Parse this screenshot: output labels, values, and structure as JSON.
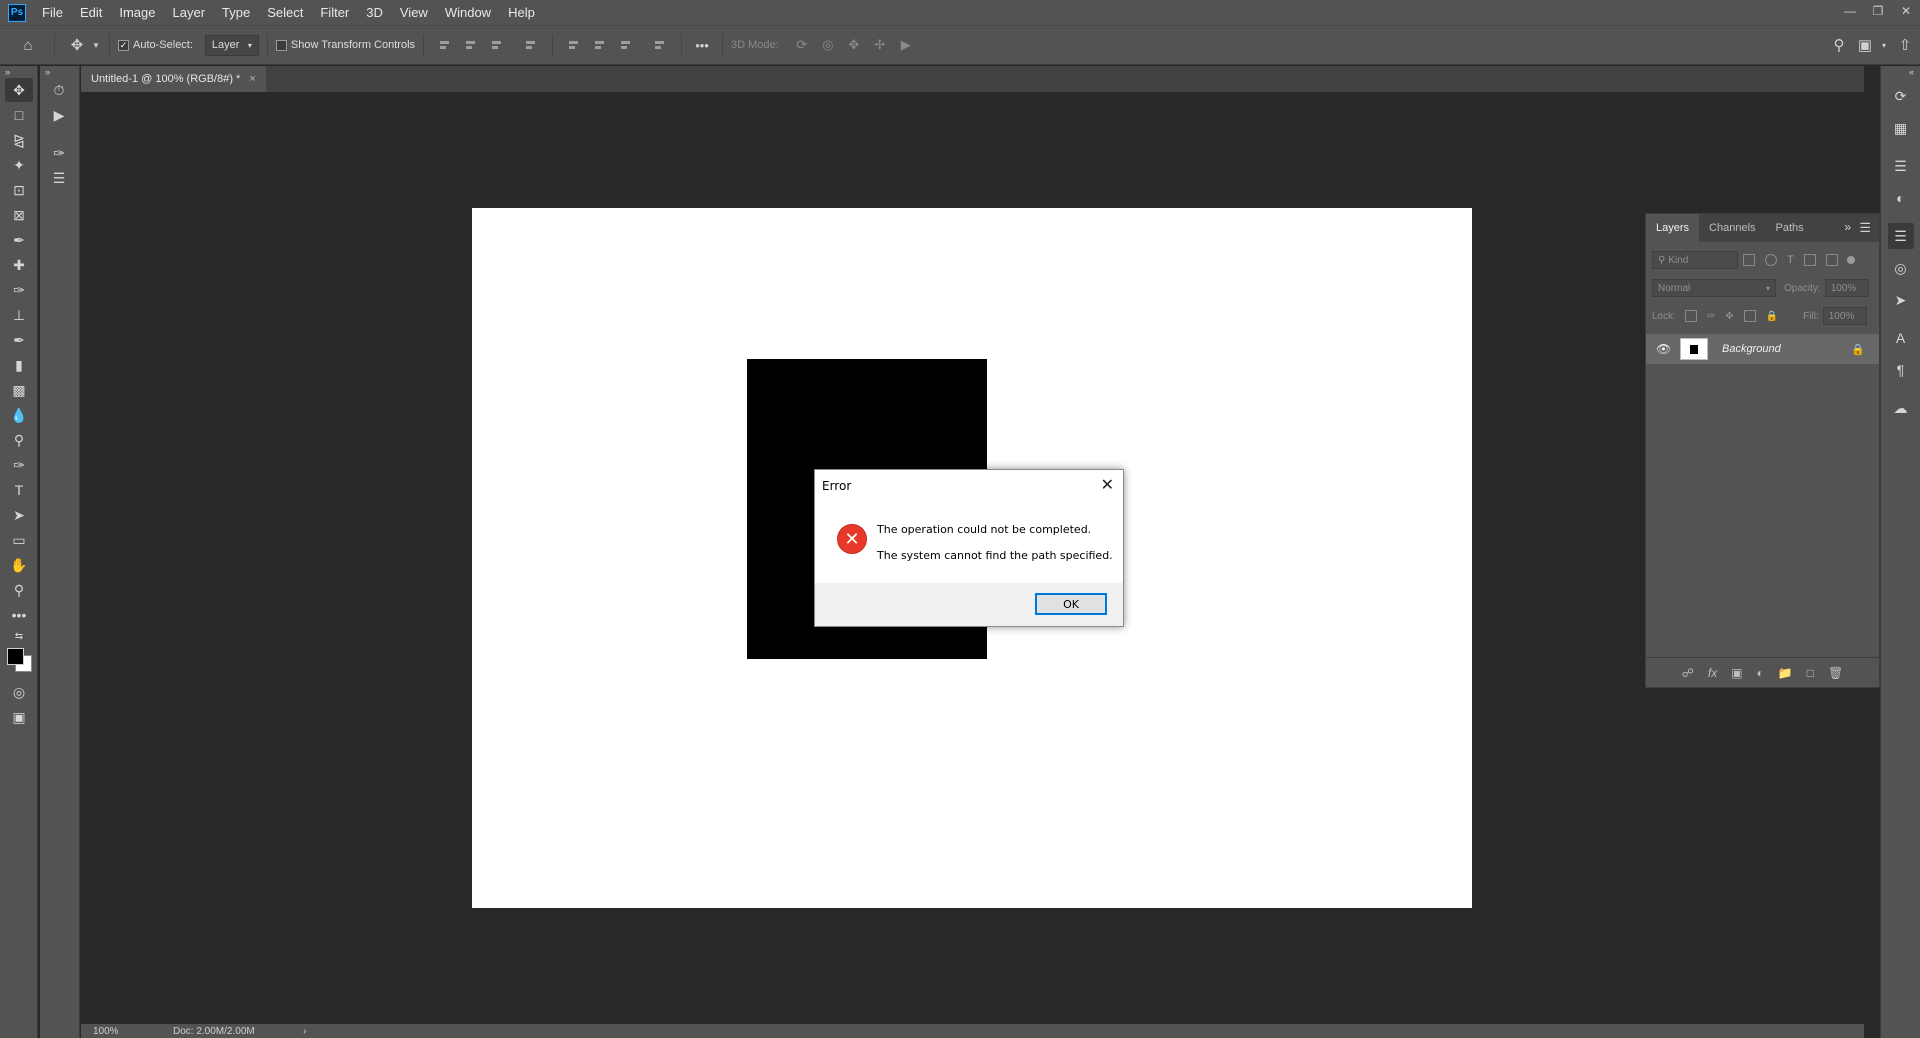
{
  "menu": {
    "logo": "Ps",
    "items": [
      "File",
      "Edit",
      "Image",
      "Layer",
      "Type",
      "Select",
      "Filter",
      "3D",
      "View",
      "Window",
      "Help"
    ]
  },
  "options": {
    "auto_select_label": "Auto-Select:",
    "auto_select_value": "Layer",
    "show_transform_label": "Show Transform Controls",
    "mode_3d_label": "3D Mode:"
  },
  "document": {
    "tab_title": "Untitled-1 @ 100% (RGB/8#) *",
    "close_glyph": "×",
    "fg_color": "#000000",
    "bg_color": "#ffffff"
  },
  "status": {
    "zoom": "100%",
    "doc_size": "Doc: 2.00M/2.00M",
    "arrow": "›"
  },
  "layers_panel": {
    "tabs": [
      "Layers",
      "Channels",
      "Paths"
    ],
    "kind_placeholder": "Kind",
    "blend_mode": "Normal",
    "opacity_label": "Opacity:",
    "opacity_value": "100%",
    "lock_label": "Lock:",
    "fill_label": "Fill:",
    "fill_value": "100%",
    "layers": [
      {
        "name": "Background",
        "visible": true,
        "locked": true
      }
    ]
  },
  "dialog": {
    "title": "Error",
    "message_line1": "The operation could not be completed.",
    "message_line2": "The system cannot find the path specified.",
    "ok_label": "OK",
    "icon": "error-icon"
  }
}
